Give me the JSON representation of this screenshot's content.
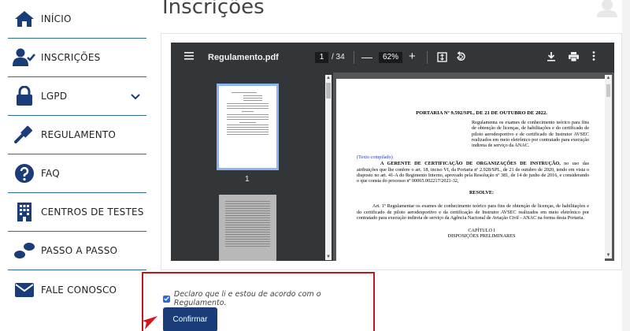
{
  "sidebar": {
    "items": [
      {
        "label": "INÍCIO",
        "icon": "home-icon"
      },
      {
        "label": "INSCRIÇÕES",
        "icon": "user-check-icon"
      },
      {
        "label": "LGPD",
        "icon": "lock-icon",
        "expandable": true
      },
      {
        "label": "REGULAMENTO",
        "icon": "gavel-icon"
      },
      {
        "label": "FAQ",
        "icon": "question-circle-icon"
      },
      {
        "label": "CENTROS DE TESTES",
        "icon": "building-icon"
      },
      {
        "label": "PASSO A PASSO",
        "icon": "footsteps-icon"
      },
      {
        "label": "FALE CONOSCO",
        "icon": "envelope-icon"
      }
    ],
    "accent_color": "#2c6e91",
    "icon_color": "#1a3c78"
  },
  "main": {
    "title": "Inscrições"
  },
  "pdf": {
    "file_name": "Regulamento.pdf",
    "current_page": "1",
    "total_pages": "/ 34",
    "zoom": "62%",
    "thumbnail_label": "1",
    "document": {
      "heading": "PORTARIA Nº 9.592/SPL, DE 21 DE OUTUBRO DE 2022.",
      "ementa": "Regulamenta os exames de conhecimento teórico para fins de obtenção de licenças, de habilitações e do certificado de piloto aerodesportivo e de certificado de Instrutor AVSEC realizados em meio eletrônico por contratado para execução indireta de serviço da ANAC.",
      "compilado": "(Texto compilado)",
      "para_lead": "A GERENTE DE CERTIFICAÇÃO DE ORGANIZAÇÕES DE INSTRUÇÃO,",
      "para_rest": " no uso das atribuições que lhe confere o art. 18, inciso VI, da Portaria nº 2.928/SPL, de 21 de outubro de 2020, tendo em vista o disposto no art. 41-A do Regimento Interno, aprovado pela Resolução nº 381, de 14 de junho de 2016, e considerando o que consta do processo nº 00065.002217/2021-32,",
      "resolve": "RESOLVE:",
      "article1": "Art. 1º Regulamentar os exames de conhecimento teórico para fins de obtenção de licenças, de habilitações e do certificado de piloto aerodesportivo e da certificação de Instrutor AVSEC realizados em meio eletrônico por contratado para execução indireta de serviço da Agência Nacional de Aviação Civil - ANAC na forma desta Portaria.",
      "chapter": "CAPÍTULO I",
      "chapter_title": "DISPOSIÇÕES PRELIMINARES"
    }
  },
  "agreement": {
    "checked": true,
    "text": "Declaro que li e estou de acordo com o Regulamento.",
    "confirm_label": "Confirmar",
    "border_color": "#c0161c"
  }
}
